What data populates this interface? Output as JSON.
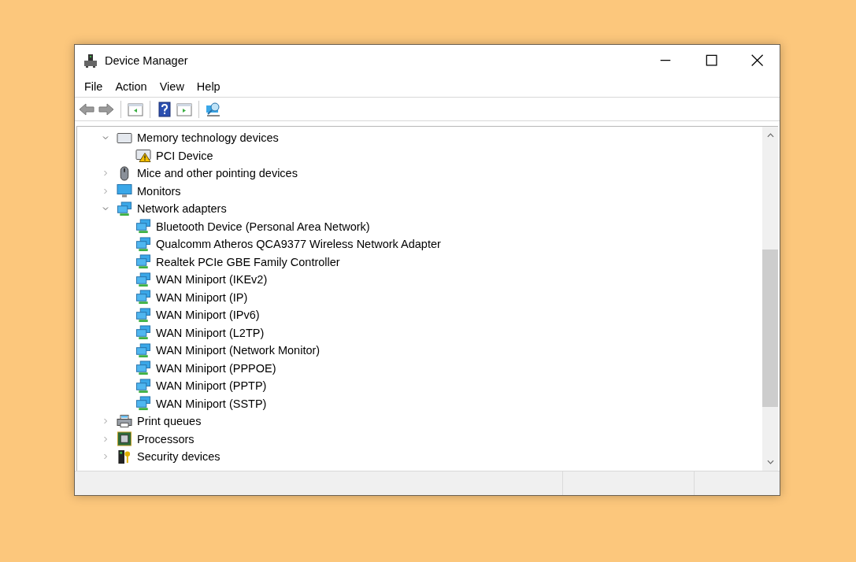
{
  "window": {
    "title": "Device Manager"
  },
  "menu": [
    "File",
    "Action",
    "View",
    "Help"
  ],
  "tree": [
    {
      "label": "Memory technology devices",
      "kind": "memory",
      "expanded": true,
      "children": [
        {
          "label": "PCI Device",
          "kind": "device-warning"
        }
      ]
    },
    {
      "label": "Mice and other pointing devices",
      "kind": "mouse",
      "expanded": false
    },
    {
      "label": "Monitors",
      "kind": "monitor",
      "expanded": false
    },
    {
      "label": "Network adapters",
      "kind": "network",
      "expanded": true,
      "children": [
        {
          "label": "Bluetooth Device (Personal Area Network)",
          "kind": "network"
        },
        {
          "label": "Qualcomm Atheros QCA9377 Wireless Network Adapter",
          "kind": "network"
        },
        {
          "label": "Realtek PCIe GBE Family Controller",
          "kind": "network"
        },
        {
          "label": "WAN Miniport (IKEv2)",
          "kind": "network"
        },
        {
          "label": "WAN Miniport (IP)",
          "kind": "network"
        },
        {
          "label": "WAN Miniport (IPv6)",
          "kind": "network"
        },
        {
          "label": "WAN Miniport (L2TP)",
          "kind": "network"
        },
        {
          "label": "WAN Miniport (Network Monitor)",
          "kind": "network"
        },
        {
          "label": "WAN Miniport (PPPOE)",
          "kind": "network"
        },
        {
          "label": "WAN Miniport (PPTP)",
          "kind": "network"
        },
        {
          "label": "WAN Miniport (SSTP)",
          "kind": "network"
        }
      ]
    },
    {
      "label": "Print queues",
      "kind": "printer",
      "expanded": false
    },
    {
      "label": "Processors",
      "kind": "processor",
      "expanded": false
    },
    {
      "label": "Security devices",
      "kind": "security",
      "expanded": false
    }
  ]
}
